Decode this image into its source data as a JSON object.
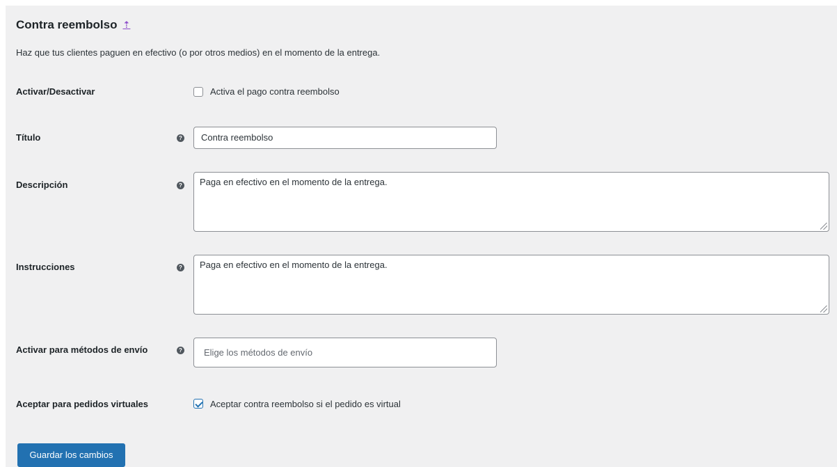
{
  "section": {
    "title": "Contra reembolso",
    "title_link_symbol": "⇡",
    "description": "Haz que tus clientes paguen en efectivo (o por otros medios) en el momento de la entrega."
  },
  "fields": {
    "enable": {
      "label": "Activar/Desactivar",
      "checkbox_label": "Activa el pago contra reembolso",
      "checked": false
    },
    "title": {
      "label": "Título",
      "value": "Contra reembolso"
    },
    "description": {
      "label": "Descripción",
      "value": "Paga en efectivo en el momento de la entrega."
    },
    "instructions": {
      "label": "Instrucciones",
      "value": "Paga en efectivo en el momento de la entrega."
    },
    "shipping_methods": {
      "label": "Activar para métodos de envío",
      "placeholder": "Elige los métodos de envío"
    },
    "virtual_orders": {
      "label": "Aceptar para pedidos virtuales",
      "checkbox_label": "Aceptar contra reembolso si el pedido es virtual",
      "checked": true
    }
  },
  "help_icon_text": "?",
  "actions": {
    "save_label": "Guardar los cambios"
  },
  "colors": {
    "panel_bg": "#f0f0f1",
    "accent": "#2271b1",
    "link": "#8c4cc9"
  }
}
